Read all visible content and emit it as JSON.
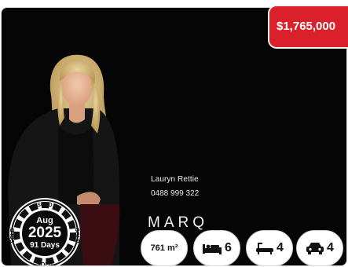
{
  "listing": {
    "price": "$1,765,000",
    "agent_name": "Lauryn Rettie",
    "agent_phone": "0488 999 322",
    "brand": "MARQ"
  },
  "sold_seal": {
    "ring_text": "SOLD",
    "month": "Aug",
    "year": "2025",
    "days": "91 Days"
  },
  "features": {
    "land_area": "761 m²",
    "bedrooms": "6",
    "bathrooms": "4",
    "car_spaces": "4",
    "icons": [
      "bed-icon",
      "bath-icon",
      "car-icon"
    ]
  },
  "colors": {
    "price_badge": "#d9202b",
    "card_background": "#050505"
  }
}
